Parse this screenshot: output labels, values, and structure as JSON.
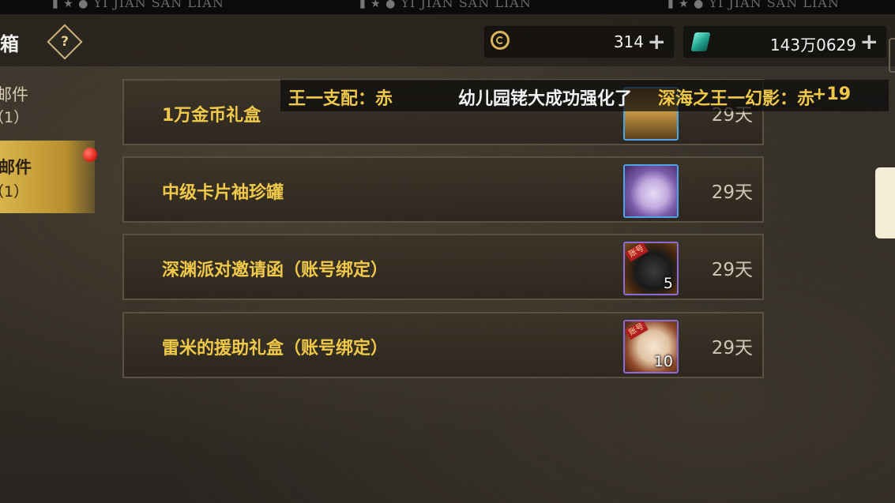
{
  "watermark": {
    "text": "YI JIAN SAN LIAN",
    "icons": [
      "thumbs-up-icon",
      "star-icon",
      "coin-icon"
    ]
  },
  "header": {
    "title": "邮箱",
    "title_visible": "邮箱",
    "help_label": "?",
    "gold": {
      "value": "314",
      "plus": "+"
    },
    "gems": {
      "value": "143万0629",
      "plus": "+"
    }
  },
  "sidebar": {
    "tabs": [
      {
        "label": "邮件",
        "count": "（1）",
        "active": false
      },
      {
        "label": "邮件",
        "count": "（1）",
        "active": true
      }
    ]
  },
  "banner": {
    "left": "王一支配：赤",
    "user": "幼儿园铑大成功强化了",
    "item": "深海之王一幻影：赤",
    "level": "+19"
  },
  "mails": [
    {
      "title": "1万金币礼盒",
      "days": "29天",
      "icon": "gift-chest-icon",
      "qty": "",
      "tag": ""
    },
    {
      "title": "中级卡片袖珍罐",
      "days": "29天",
      "icon": "card-jar-icon",
      "qty": "",
      "tag": ""
    },
    {
      "title": "深渊派对邀请函（账号绑定）",
      "days": "29天",
      "icon": "abyss-invitation-icon",
      "qty": "5",
      "tag": "账号"
    },
    {
      "title": "雷米的援助礼盒（账号绑定）",
      "days": "29天",
      "icon": "remy-gift-icon",
      "qty": "10",
      "tag": "账号"
    }
  ],
  "colors": {
    "accent_gold": "#f0c94a",
    "active_tab": "#d9b44a",
    "notify_red": "#e3261b"
  }
}
